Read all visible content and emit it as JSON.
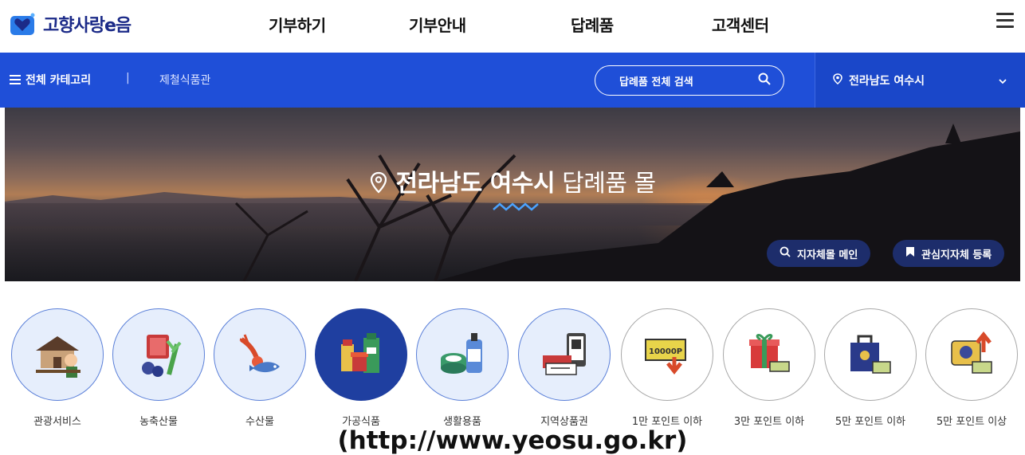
{
  "header": {
    "logo_text": "고향사랑e음",
    "nav": [
      "기부하기",
      "기부안내",
      "답례품",
      "고객센터"
    ]
  },
  "catbar": {
    "all_category": "전체 카테고리",
    "separator": "|",
    "sub_category": "제철식품관",
    "search_label": "답례품 전체 검색",
    "region": "전라남도 여수시"
  },
  "banner": {
    "region": "전라남도 여수시",
    "suffix": "답례품 몰",
    "main_button": "지자체몰 메인",
    "fav_button": "관심지자체 등록"
  },
  "categories": [
    {
      "label": "관광서비스",
      "icon": "tour-icon"
    },
    {
      "label": "농축산물",
      "icon": "farm-icon"
    },
    {
      "label": "수산물",
      "icon": "seafood-icon"
    },
    {
      "label": "가공식품",
      "icon": "processed-food-icon"
    },
    {
      "label": "생활용품",
      "icon": "household-icon"
    },
    {
      "label": "지역상품권",
      "icon": "voucher-icon"
    },
    {
      "label": "1만 포인트 이하",
      "icon": "points-icon"
    },
    {
      "label": "3만 포인트 이하",
      "icon": "gift-icon"
    },
    {
      "label": "5만 포인트 이하",
      "icon": "bag-icon"
    },
    {
      "label": "5만 포인트 이상",
      "icon": "premium-gift-icon"
    }
  ],
  "caption": "(http://www.yeosu.go.kr)",
  "colors": {
    "primary_blue": "#1f4fd8",
    "navy": "#1d2d6b",
    "active_circle": "#1f3fa0",
    "wave": "#4aa3ff"
  }
}
